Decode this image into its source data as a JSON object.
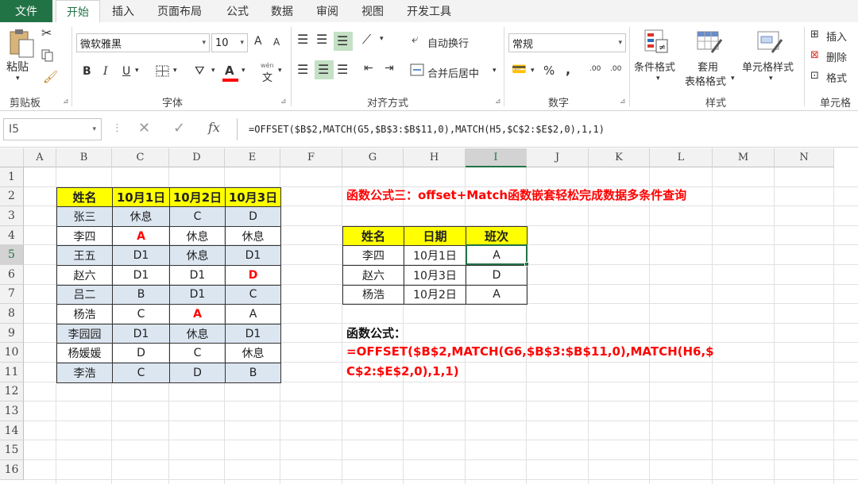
{
  "tabs": {
    "file": "文件",
    "items": [
      "开始",
      "插入",
      "页面布局",
      "公式",
      "数据",
      "审阅",
      "视图",
      "开发工具"
    ],
    "active": "开始"
  },
  "ribbon": {
    "clipboard": {
      "paste": "粘贴",
      "label": "剪贴板"
    },
    "font": {
      "name": "微软雅黑",
      "size": "10",
      "bold": "B",
      "italic": "I",
      "underline": "U",
      "color_a": "A",
      "wen": "wén",
      "wen2": "文",
      "grow": "A",
      "shrink": "A",
      "label": "字体"
    },
    "alignment": {
      "wrap": "自动换行",
      "merge": "合并后居中",
      "label": "对齐方式"
    },
    "number": {
      "format": "常规",
      "percent": "%",
      "comma": ",",
      "inc": ".00",
      "label": "数字"
    },
    "styles": {
      "conditional": "条件格式",
      "table_line1": "套用",
      "table_line2": "表格格式",
      "cell_styles": "单元格样式",
      "label": "样式"
    },
    "cells": {
      "insert": "插入",
      "delete": "删除",
      "format": "格式",
      "label": "单元格"
    }
  },
  "formula_bar": {
    "name_box": "I5",
    "cancel": "✕",
    "enter": "✓",
    "fx": "fx",
    "formula": "=OFFSET($B$2,MATCH(G5,$B$3:$B$11,0),MATCH(H5,$C$2:$E$2,0),1,1)"
  },
  "sheet": {
    "columns": [
      "A",
      "B",
      "C",
      "D",
      "E",
      "F",
      "G",
      "H",
      "I",
      "J",
      "K",
      "L",
      "M",
      "N"
    ],
    "rows": [
      "1",
      "2",
      "3",
      "4",
      "5",
      "6",
      "7",
      "8",
      "9",
      "10",
      "11",
      "12",
      "13",
      "14",
      "15",
      "16"
    ],
    "active_col": "I",
    "active_row": "5",
    "left_table": {
      "headers": [
        "姓名",
        "10月1日",
        "10月2日",
        "10月3日"
      ],
      "rows": [
        [
          "张三",
          "休息",
          "C",
          "D"
        ],
        [
          "李四",
          "A",
          "休息",
          "休息"
        ],
        [
          "王五",
          "D1",
          "休息",
          "D1"
        ],
        [
          "赵六",
          "D1",
          "D1",
          "D"
        ],
        [
          "吕二",
          "B",
          "D1",
          "C"
        ],
        [
          "杨浩",
          "C",
          "A",
          "A"
        ],
        [
          "李园园",
          "D1",
          "休息",
          "D1"
        ],
        [
          "杨媛媛",
          "D",
          "C",
          "休息"
        ],
        [
          "李浩",
          "C",
          "D",
          "B"
        ]
      ]
    },
    "title": "函数公式三：offset+Match函数嵌套轻松完成数据多条件查询",
    "right_table": {
      "headers": [
        "姓名",
        "日期",
        "班次"
      ],
      "rows": [
        [
          "李四",
          "10月1日",
          "A"
        ],
        [
          "赵六",
          "10月3日",
          "D"
        ],
        [
          "杨浩",
          "10月2日",
          "A"
        ]
      ]
    },
    "formula_label": "函数公式：",
    "formula_line1": "=OFFSET($B$2,MATCH(G6,$B$3:$B$11,0),MATCH(H6,$",
    "formula_line2": "C$2:$E$2,0),1,1)"
  },
  "colors": {
    "excel_green": "#217346",
    "header_yellow": "#ffff00",
    "band_blue": "#dce6f1",
    "red": "#ff0000"
  }
}
